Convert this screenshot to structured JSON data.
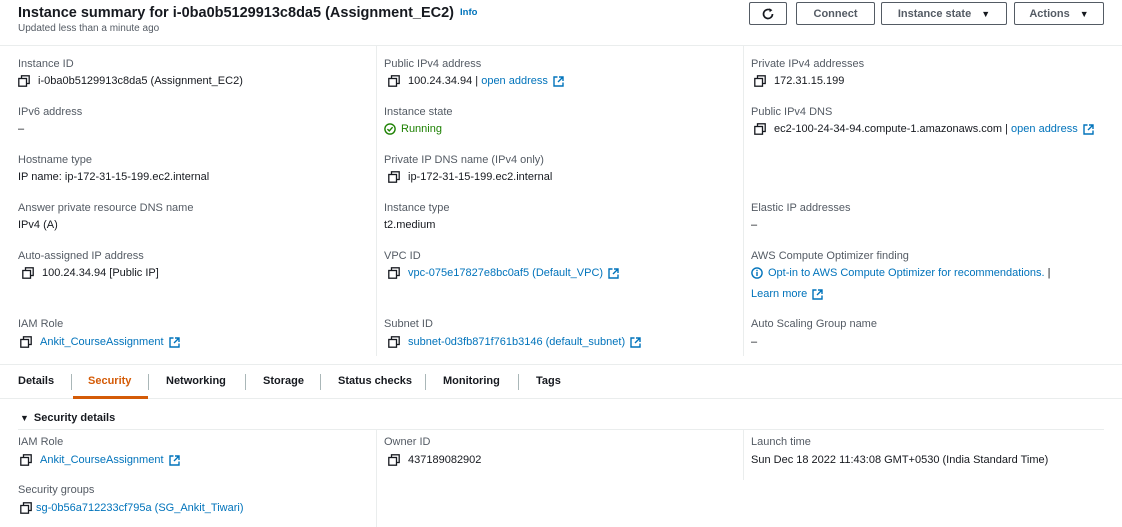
{
  "header": {
    "title": "Instance summary for i-0ba0b5129913c8da5 (Assignment_EC2)",
    "info": "Info",
    "updated": "Updated less than a minute ago",
    "buttons": {
      "connect": "Connect",
      "instance_state": "Instance state",
      "actions": "Actions"
    }
  },
  "summary": {
    "instance_id": {
      "label": "Instance ID",
      "value": "i-0ba0b5129913c8da5 (Assignment_EC2)"
    },
    "public_ipv4": {
      "label": "Public IPv4 address",
      "value": "100.24.34.94 | ",
      "link": "open address"
    },
    "private_ipv4": {
      "label": "Private IPv4 addresses",
      "value": "172.31.15.199"
    },
    "ipv6": {
      "label": "IPv6 address",
      "value": "–"
    },
    "instance_state": {
      "label": "Instance state",
      "value": "Running"
    },
    "public_dns": {
      "label": "Public IPv4 DNS",
      "value": "ec2-100-24-34-94.compute-1.amazonaws.com | ",
      "link": "open address"
    },
    "hostname_type": {
      "label": "Hostname type",
      "value": "IP name: ip-172-31-15-199.ec2.internal"
    },
    "private_dns": {
      "label": "Private IP DNS name (IPv4 only)",
      "value": "ip-172-31-15-199.ec2.internal"
    },
    "answer_dns": {
      "label": "Answer private resource DNS name",
      "value": "IPv4 (A)"
    },
    "instance_type": {
      "label": "Instance type",
      "value": "t2.medium"
    },
    "elastic_ip": {
      "label": "Elastic IP addresses",
      "value": "–"
    },
    "auto_ip": {
      "label": "Auto-assigned IP address",
      "value": "100.24.34.94 [Public IP]"
    },
    "vpc_id": {
      "label": "VPC ID",
      "value": "vpc-075e17827e8bc0af5 (Default_VPC)"
    },
    "optimizer": {
      "label": "AWS Compute Optimizer finding",
      "value": "Opt-in to AWS Compute Optimizer for recommendations.",
      "sep": " |",
      "learn_more": "Learn more"
    },
    "iam_role": {
      "label": "IAM Role",
      "value": "Ankit_CourseAssignment"
    },
    "subnet_id": {
      "label": "Subnet ID",
      "value": "subnet-0d3fb871f761b3146 (default_subnet)"
    },
    "asg": {
      "label": "Auto Scaling Group name",
      "value": "–"
    }
  },
  "tabs": [
    "Details",
    "Security",
    "Networking",
    "Storage",
    "Status checks",
    "Monitoring",
    "Tags"
  ],
  "active_tab": "Security",
  "security": {
    "section_title": "Security details",
    "iam_role": {
      "label": "IAM Role",
      "value": "Ankit_CourseAssignment"
    },
    "owner_id": {
      "label": "Owner ID",
      "value": "437189082902"
    },
    "launch_time": {
      "label": "Launch time",
      "value": "Sun Dec 18 2022 11:43:08 GMT+0530 (India Standard Time)"
    },
    "security_groups": {
      "label": "Security groups",
      "value": "sg-0b56a712233cf795a (SG_Ankit_Tiwari)"
    }
  },
  "colors": {
    "link": "#0073bb",
    "active_tab": "#d45b07",
    "success": "#1d8102",
    "text": "#16191f",
    "muted": "#545b64"
  }
}
